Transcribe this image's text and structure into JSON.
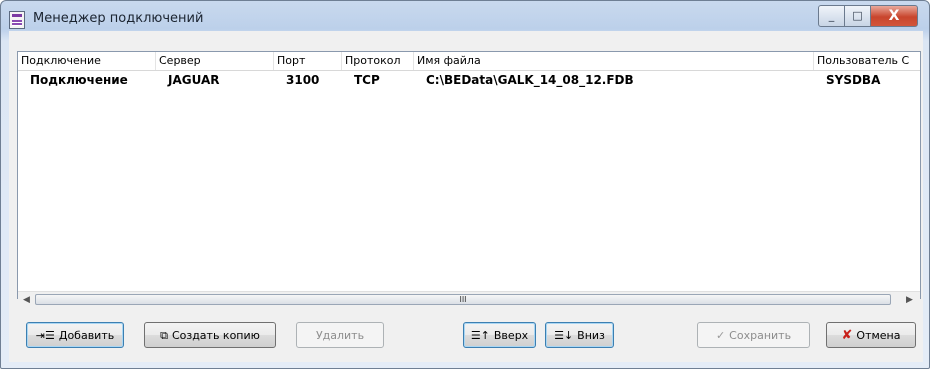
{
  "window": {
    "title": "Менеджер подключений",
    "controls": {
      "minimize": "_",
      "maximize": "□",
      "close": "X"
    }
  },
  "grid": {
    "columns": [
      "Подключение",
      "Сервер",
      "Порт",
      "Протокол",
      "Имя файла",
      "Пользователь С"
    ],
    "rows": [
      [
        "Подключение",
        "JAGUAR",
        "3100",
        "TCP",
        "C:\\BEData\\GALK_14_08_12.FDB",
        "SYSDBA"
      ]
    ],
    "scroll_thumb_grip": "III"
  },
  "buttons": {
    "add": "Добавить",
    "copy": "Создать копию",
    "delete": "Удалить",
    "up": "Вверх",
    "down": "Вниз",
    "save": "Сохранить",
    "cancel": "Отмена"
  },
  "icons": {
    "add": "add-connection-icon",
    "copy": "copy-icon",
    "up": "move-up-icon",
    "down": "move-down-icon",
    "save": "checkmark-icon",
    "cancel": "red-x-icon"
  },
  "colors": {
    "cancel_icon": "#c8201a",
    "title_gradient": "#bcd0ea"
  }
}
